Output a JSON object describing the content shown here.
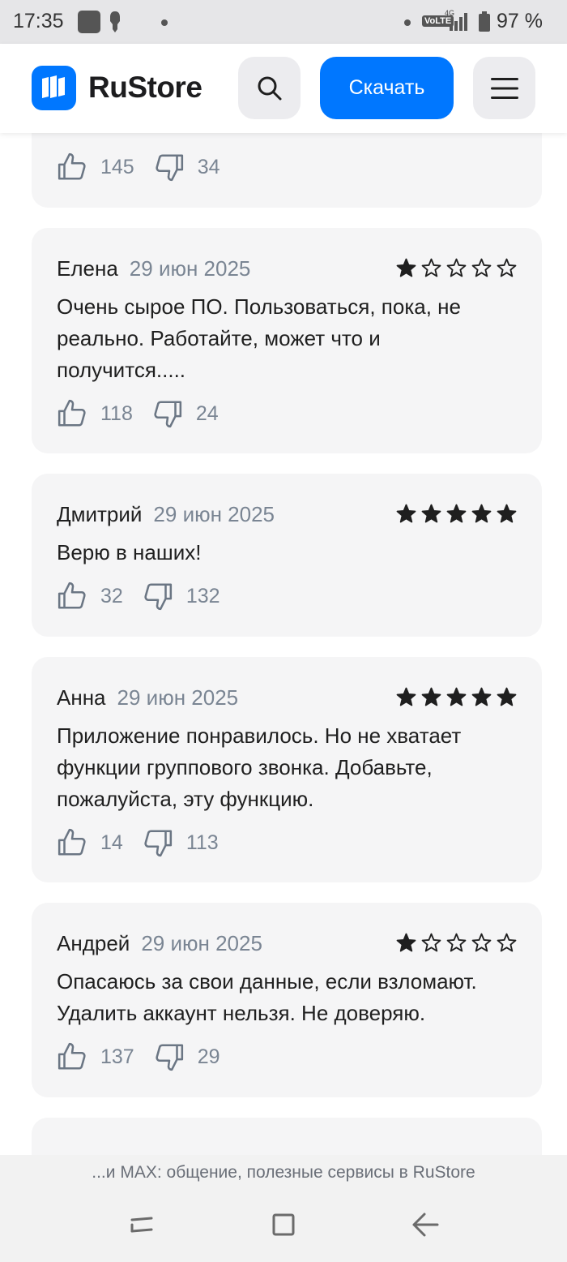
{
  "status_bar": {
    "time": "17:35",
    "network": "VoLTE",
    "network_gen": "4G",
    "battery": "97 %"
  },
  "header": {
    "brand": "RuStore",
    "download_label": "Скачать",
    "accent": "#0077ff"
  },
  "reviews": [
    {
      "author": "",
      "date": "",
      "rating": null,
      "text": "",
      "likes": "145",
      "dislikes": "34"
    },
    {
      "author": "Елена",
      "date": "29 июн 2025",
      "rating": 1,
      "text": "Очень сырое ПО. Пользоваться, пока, не реально. Работайте, может что и получится.....",
      "likes": "118",
      "dislikes": "24"
    },
    {
      "author": "Дмитрий",
      "date": "29 июн 2025",
      "rating": 5,
      "text": "Верю в наших!",
      "likes": "32",
      "dislikes": "132"
    },
    {
      "author": "Анна",
      "date": "29 июн 2025",
      "rating": 5,
      "text": "Приложение понравилось. Но не хватает функции группового звонка. Добавьте, пожалуйста, эту функцию.",
      "likes": "14",
      "dislikes": "113"
    },
    {
      "author": "Андрей",
      "date": "29 июн 2025",
      "rating": 1,
      "text": "Опасаюсь за свои данные, если взломают. Удалить аккаунт нельзя. Не доверяю.",
      "likes": "137",
      "dislikes": "29"
    }
  ],
  "bottom_bar": {
    "page_title": "...и MAX: общение, полезные сервисы в RuStore"
  }
}
